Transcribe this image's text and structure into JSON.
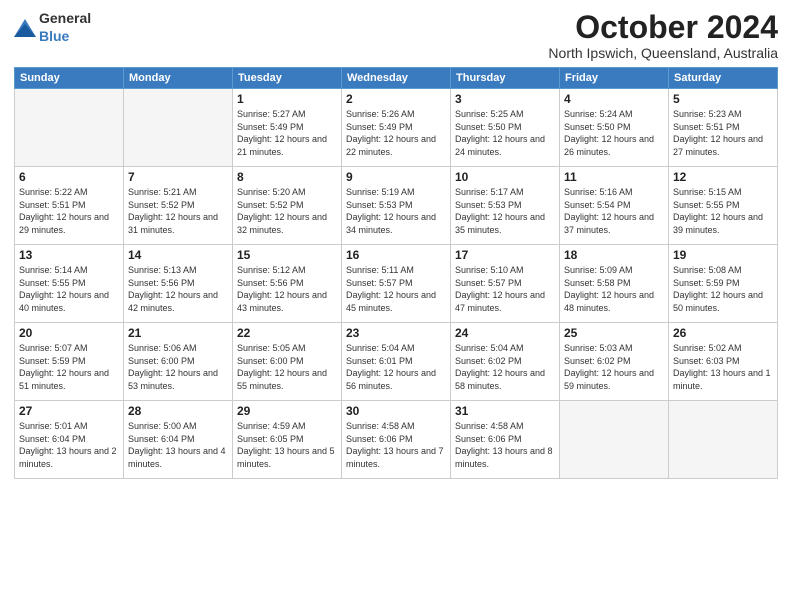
{
  "header": {
    "logo_general": "General",
    "logo_blue": "Blue",
    "month": "October 2024",
    "location": "North Ipswich, Queensland, Australia"
  },
  "days_of_week": [
    "Sunday",
    "Monday",
    "Tuesday",
    "Wednesday",
    "Thursday",
    "Friday",
    "Saturday"
  ],
  "weeks": [
    [
      {
        "day": "",
        "empty": true
      },
      {
        "day": "",
        "empty": true
      },
      {
        "day": "1",
        "sunrise": "5:27 AM",
        "sunset": "5:49 PM",
        "daylight": "12 hours and 21 minutes."
      },
      {
        "day": "2",
        "sunrise": "5:26 AM",
        "sunset": "5:49 PM",
        "daylight": "12 hours and 22 minutes."
      },
      {
        "day": "3",
        "sunrise": "5:25 AM",
        "sunset": "5:50 PM",
        "daylight": "12 hours and 24 minutes."
      },
      {
        "day": "4",
        "sunrise": "5:24 AM",
        "sunset": "5:50 PM",
        "daylight": "12 hours and 26 minutes."
      },
      {
        "day": "5",
        "sunrise": "5:23 AM",
        "sunset": "5:51 PM",
        "daylight": "12 hours and 27 minutes."
      }
    ],
    [
      {
        "day": "6",
        "sunrise": "5:22 AM",
        "sunset": "5:51 PM",
        "daylight": "12 hours and 29 minutes."
      },
      {
        "day": "7",
        "sunrise": "5:21 AM",
        "sunset": "5:52 PM",
        "daylight": "12 hours and 31 minutes."
      },
      {
        "day": "8",
        "sunrise": "5:20 AM",
        "sunset": "5:52 PM",
        "daylight": "12 hours and 32 minutes."
      },
      {
        "day": "9",
        "sunrise": "5:19 AM",
        "sunset": "5:53 PM",
        "daylight": "12 hours and 34 minutes."
      },
      {
        "day": "10",
        "sunrise": "5:17 AM",
        "sunset": "5:53 PM",
        "daylight": "12 hours and 35 minutes."
      },
      {
        "day": "11",
        "sunrise": "5:16 AM",
        "sunset": "5:54 PM",
        "daylight": "12 hours and 37 minutes."
      },
      {
        "day": "12",
        "sunrise": "5:15 AM",
        "sunset": "5:55 PM",
        "daylight": "12 hours and 39 minutes."
      }
    ],
    [
      {
        "day": "13",
        "sunrise": "5:14 AM",
        "sunset": "5:55 PM",
        "daylight": "12 hours and 40 minutes."
      },
      {
        "day": "14",
        "sunrise": "5:13 AM",
        "sunset": "5:56 PM",
        "daylight": "12 hours and 42 minutes."
      },
      {
        "day": "15",
        "sunrise": "5:12 AM",
        "sunset": "5:56 PM",
        "daylight": "12 hours and 43 minutes."
      },
      {
        "day": "16",
        "sunrise": "5:11 AM",
        "sunset": "5:57 PM",
        "daylight": "12 hours and 45 minutes."
      },
      {
        "day": "17",
        "sunrise": "5:10 AM",
        "sunset": "5:57 PM",
        "daylight": "12 hours and 47 minutes."
      },
      {
        "day": "18",
        "sunrise": "5:09 AM",
        "sunset": "5:58 PM",
        "daylight": "12 hours and 48 minutes."
      },
      {
        "day": "19",
        "sunrise": "5:08 AM",
        "sunset": "5:59 PM",
        "daylight": "12 hours and 50 minutes."
      }
    ],
    [
      {
        "day": "20",
        "sunrise": "5:07 AM",
        "sunset": "5:59 PM",
        "daylight": "12 hours and 51 minutes."
      },
      {
        "day": "21",
        "sunrise": "5:06 AM",
        "sunset": "6:00 PM",
        "daylight": "12 hours and 53 minutes."
      },
      {
        "day": "22",
        "sunrise": "5:05 AM",
        "sunset": "6:00 PM",
        "daylight": "12 hours and 55 minutes."
      },
      {
        "day": "23",
        "sunrise": "5:04 AM",
        "sunset": "6:01 PM",
        "daylight": "12 hours and 56 minutes."
      },
      {
        "day": "24",
        "sunrise": "5:04 AM",
        "sunset": "6:02 PM",
        "daylight": "12 hours and 58 minutes."
      },
      {
        "day": "25",
        "sunrise": "5:03 AM",
        "sunset": "6:02 PM",
        "daylight": "12 hours and 59 minutes."
      },
      {
        "day": "26",
        "sunrise": "5:02 AM",
        "sunset": "6:03 PM",
        "daylight": "13 hours and 1 minute."
      }
    ],
    [
      {
        "day": "27",
        "sunrise": "5:01 AM",
        "sunset": "6:04 PM",
        "daylight": "13 hours and 2 minutes."
      },
      {
        "day": "28",
        "sunrise": "5:00 AM",
        "sunset": "6:04 PM",
        "daylight": "13 hours and 4 minutes."
      },
      {
        "day": "29",
        "sunrise": "4:59 AM",
        "sunset": "6:05 PM",
        "daylight": "13 hours and 5 minutes."
      },
      {
        "day": "30",
        "sunrise": "4:58 AM",
        "sunset": "6:06 PM",
        "daylight": "13 hours and 7 minutes."
      },
      {
        "day": "31",
        "sunrise": "4:58 AM",
        "sunset": "6:06 PM",
        "daylight": "13 hours and 8 minutes."
      },
      {
        "day": "",
        "empty": true
      },
      {
        "day": "",
        "empty": true
      }
    ]
  ]
}
